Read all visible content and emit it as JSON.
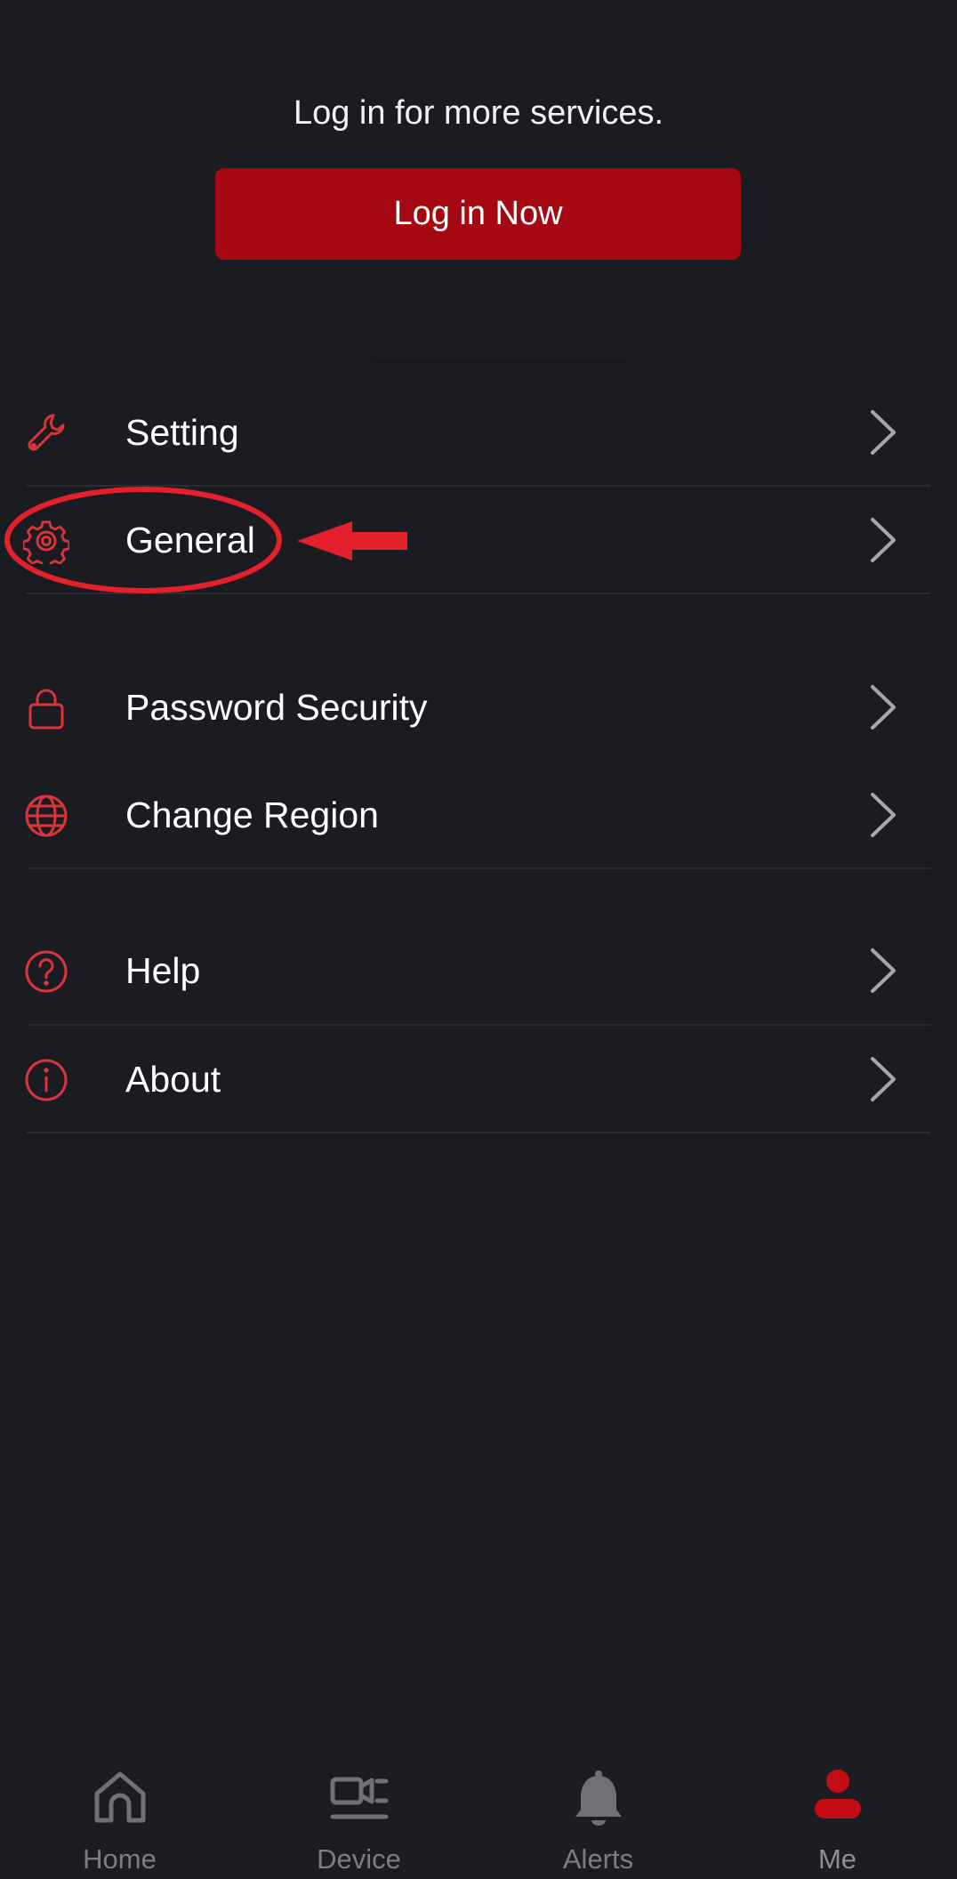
{
  "login": {
    "prompt": "Log in for more services.",
    "button_label": "Log in Now",
    "button_color": "#a50811"
  },
  "menu": {
    "items": [
      {
        "label": "Setting",
        "icon": "wrench-icon"
      },
      {
        "label": "General",
        "icon": "gear-icon"
      },
      {
        "label": "Password Security",
        "icon": "lock-icon"
      },
      {
        "label": "Change Region",
        "icon": "globe-icon"
      },
      {
        "label": "Help",
        "icon": "question-circle-icon"
      },
      {
        "label": "About",
        "icon": "info-circle-icon"
      }
    ],
    "icon_color": "#d8343a",
    "chevron_color": "#a6a7ab"
  },
  "annotation": {
    "highlighted_item": "General",
    "color": "#e3202b"
  },
  "tabbar": {
    "tabs": [
      {
        "label": "Home",
        "icon": "home-icon",
        "active": false
      },
      {
        "label": "Device",
        "icon": "video-camera-icon",
        "active": false
      },
      {
        "label": "Alerts",
        "icon": "bell-icon",
        "active": false
      },
      {
        "label": "Me",
        "icon": "person-icon",
        "active": true
      }
    ],
    "active_color": "#c40c14",
    "inactive_color": "#6f7177"
  }
}
